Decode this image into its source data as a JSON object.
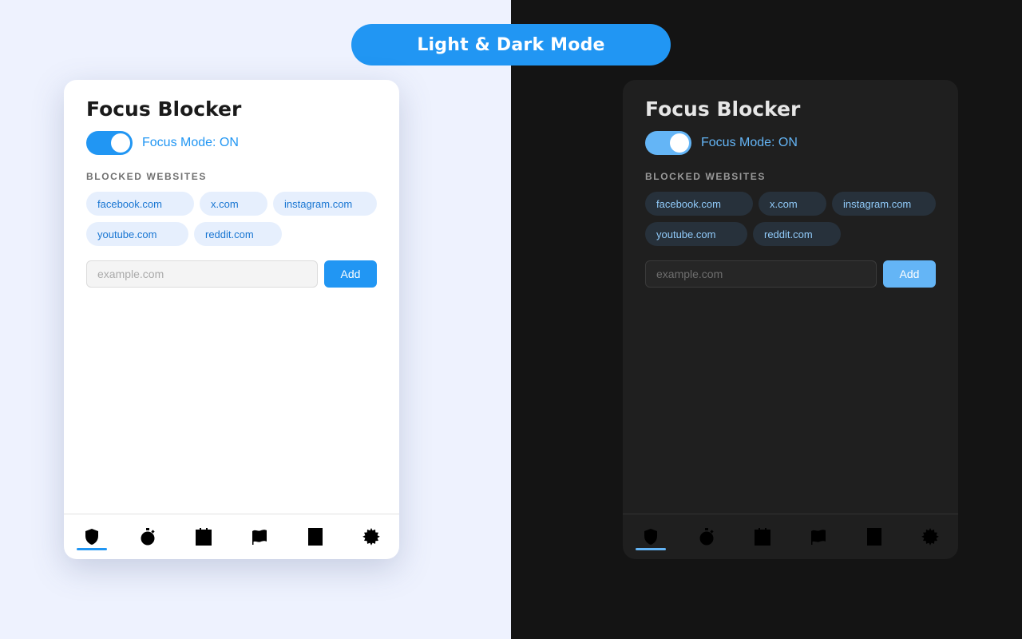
{
  "banner": {
    "title": "Light & Dark Mode"
  },
  "colors": {
    "accent": "#2196f3",
    "accent_dark": "#64b5f6",
    "light_background": "#eef2fe",
    "dark_background": "#141414"
  },
  "popup": {
    "title": "Focus Blocker",
    "focus_mode": {
      "label": "Focus Mode: ON",
      "enabled": true
    },
    "blocked_section_label": "BLOCKED WEBSITES",
    "blocked_sites": [
      "facebook.com",
      "x.com",
      "instagram.com",
      "youtube.com",
      "reddit.com"
    ],
    "input": {
      "placeholder": "example.com",
      "value": ""
    },
    "add_button_label": "Add",
    "nav_icons": [
      "shield-icon",
      "stopwatch-icon",
      "calendar-icon",
      "flag-icon",
      "document-icon",
      "gear-icon"
    ],
    "active_nav_index": 0
  }
}
